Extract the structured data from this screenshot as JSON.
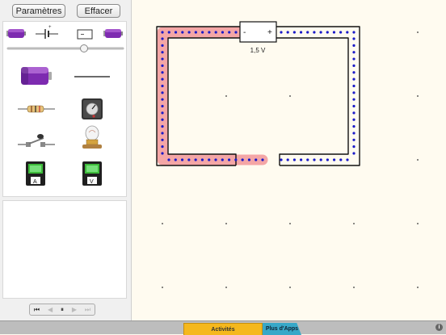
{
  "sidebar": {
    "settings_label": "Paramètres",
    "clear_label": "Effacer"
  },
  "circuit": {
    "battery_voltage": "1,5 V",
    "battery_minus": "-",
    "battery_plus": "+"
  },
  "transport": {
    "first": "⏮",
    "prev": "◀",
    "pause": "⏸",
    "next": "▶",
    "last": "⏭"
  },
  "tabs": {
    "activities": "Activités",
    "apps": "Plus d'Apps"
  },
  "info_label": "i",
  "colors": {
    "positive_trace": "#f4a0a0",
    "electron_dot": "#1a1ac8",
    "wire": "#111111",
    "canvas_bg": "#fffbf0",
    "battery_purple": "#7d2bb0"
  }
}
